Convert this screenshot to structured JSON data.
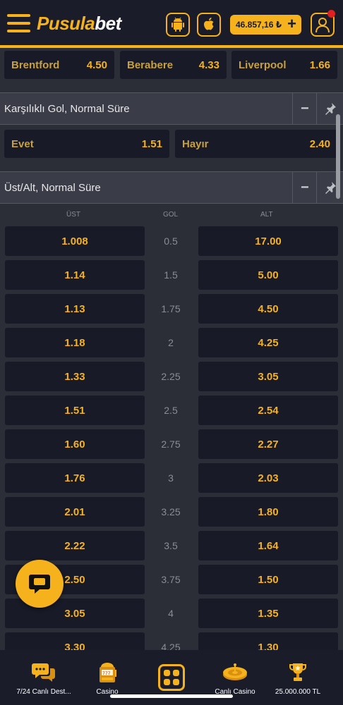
{
  "header": {
    "logo_part1": "Pusula",
    "logo_part2": "bet",
    "balance": "46.857,16 ₺",
    "balance_plus": "+"
  },
  "match_result": [
    {
      "label": "Brentford",
      "odd": "4.50"
    },
    {
      "label": "Berabere",
      "odd": "4.33"
    },
    {
      "label": "Liverpool",
      "odd": "1.66"
    }
  ],
  "btts": {
    "title": "Karşılıklı Gol, Normal Süre",
    "options": [
      {
        "label": "Evet",
        "odd": "1.51"
      },
      {
        "label": "Hayır",
        "odd": "2.40"
      }
    ]
  },
  "over_under": {
    "title": "Üst/Alt, Normal Süre",
    "col_over": "ÜST",
    "col_goal": "GOL",
    "col_under": "ALT",
    "rows": [
      {
        "over": "1.008",
        "goal": "0.5",
        "under": "17.00"
      },
      {
        "over": "1.14",
        "goal": "1.5",
        "under": "5.00"
      },
      {
        "over": "1.13",
        "goal": "1.75",
        "under": "4.50"
      },
      {
        "over": "1.18",
        "goal": "2",
        "under": "4.25"
      },
      {
        "over": "1.33",
        "goal": "2.25",
        "under": "3.05"
      },
      {
        "over": "1.51",
        "goal": "2.5",
        "under": "2.54"
      },
      {
        "over": "1.60",
        "goal": "2.75",
        "under": "2.27"
      },
      {
        "over": "1.76",
        "goal": "3",
        "under": "2.03"
      },
      {
        "over": "2.01",
        "goal": "3.25",
        "under": "1.80"
      },
      {
        "over": "2.22",
        "goal": "3.5",
        "under": "1.64"
      },
      {
        "over": "2.50",
        "goal": "3.75",
        "under": "1.50"
      },
      {
        "over": "3.05",
        "goal": "4",
        "under": "1.35"
      },
      {
        "over": "3.30",
        "goal": "4.25",
        "under": "1.30"
      }
    ]
  },
  "market_controls": {
    "collapse": "−"
  },
  "bottom_nav": [
    {
      "label": "7/24 Canlı Dest...",
      "icon": "chat-bubbles-icon"
    },
    {
      "label": "Casino",
      "icon": "slot-machine-icon"
    },
    {
      "label": "",
      "icon": "grid-menu-icon"
    },
    {
      "label": "Canlı Casino",
      "icon": "roulette-icon"
    },
    {
      "label": "25.000.000 TL",
      "icon": "trophy-icon"
    }
  ],
  "colors": {
    "accent": "#f5b21d",
    "background": "#2b2e37",
    "tile": "#181a27",
    "header": "#1a1c2a"
  }
}
